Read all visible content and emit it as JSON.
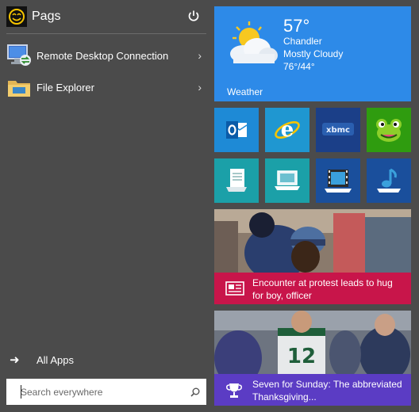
{
  "user": {
    "name": "Pags"
  },
  "apps": [
    {
      "label": "Remote Desktop Connection",
      "icon": "remote-desktop-icon"
    },
    {
      "label": "File Explorer",
      "icon": "folder-icon"
    }
  ],
  "all_apps": {
    "label": "All Apps"
  },
  "search": {
    "placeholder": "Search everywhere"
  },
  "weather": {
    "temperature": "57°",
    "city": "Chandler",
    "condition": "Mostly Cloudy",
    "range": "76°/44°",
    "label": "Weather"
  },
  "tiles": [
    {
      "name": "outlook-tile",
      "icon": "outlook-icon",
      "color": "#1e8ad6"
    },
    {
      "name": "internet-explorer-tile",
      "icon": "internet-explorer-icon",
      "color": "#1f97d1"
    },
    {
      "name": "xbmc-tile",
      "icon": "xbmc-icon",
      "color": "#1b3f88"
    },
    {
      "name": "frogger-tile",
      "icon": "frog-icon",
      "color": "#2f9c0f"
    },
    {
      "name": "document-tile",
      "icon": "document-icon",
      "color": "#1ba0a8"
    },
    {
      "name": "laptop-tile",
      "icon": "laptop-icon",
      "color": "#1ba0a8"
    },
    {
      "name": "video-tile",
      "icon": "film-icon",
      "color": "#1a4f9c"
    },
    {
      "name": "music-tile",
      "icon": "music-note-icon",
      "color": "#1a4f9c"
    }
  ],
  "news": {
    "headline": "Encounter at protest leads to hug for boy, officer",
    "color": "#c8154a"
  },
  "sports": {
    "headline": "Seven for Sunday: The abbreviated Thanksgiving...",
    "color": "#5b3cc4"
  }
}
